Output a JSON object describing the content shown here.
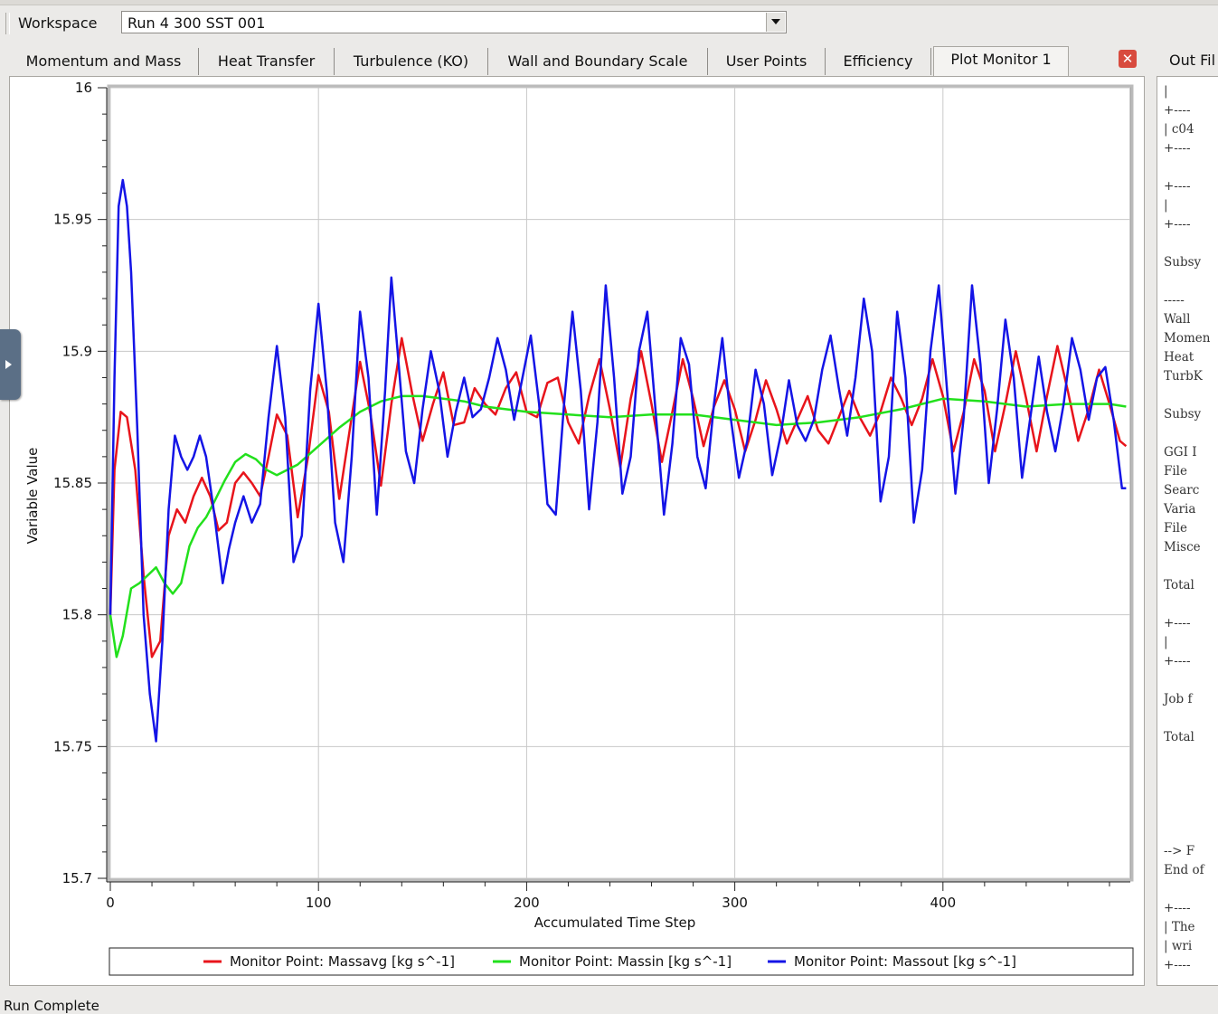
{
  "workspace": {
    "label": "Workspace",
    "selected": "Run 4 300 SST 001"
  },
  "tabs": [
    {
      "label": "Momentum and Mass",
      "active": false
    },
    {
      "label": "Heat Transfer",
      "active": false
    },
    {
      "label": "Turbulence (KO)",
      "active": false
    },
    {
      "label": "Wall and Boundary Scale",
      "active": false
    },
    {
      "label": "User Points",
      "active": false
    },
    {
      "label": "Efficiency",
      "active": false
    },
    {
      "label": "Plot Monitor 1",
      "active": true
    }
  ],
  "close_icon": "close-icon",
  "out_panel": {
    "tab_label": "Out Fil",
    "lines": [
      "|",
      "+----",
      "| c04",
      "+----",
      "",
      "+----",
      "|",
      "+----",
      "",
      "Subsy",
      "",
      "-----",
      "Wall ",
      "Momen",
      "Heat ",
      "TurbK",
      "",
      "Subsy",
      "",
      "GGI I",
      "File ",
      "Searc",
      "Varia",
      "File ",
      "Misce",
      "",
      "Total",
      "",
      "+----",
      "|",
      "+----",
      "",
      "Job f",
      "",
      "Total",
      "",
      "",
      "",
      "",
      "",
      "--> F",
      "End of",
      "",
      "+----",
      "| The",
      "| wri",
      "+----"
    ]
  },
  "status_text": "Run Complete",
  "chart_data": {
    "type": "line",
    "title": "",
    "xlabel": "Accumulated Time Step",
    "ylabel": "Variable Value",
    "xlim": [
      0,
      490
    ],
    "ylim": [
      15.7,
      16.0
    ],
    "xticks": [
      0,
      100,
      200,
      300,
      400
    ],
    "yticks": [
      15.7,
      15.75,
      15.8,
      15.85,
      15.9,
      15.95,
      16
    ],
    "ytick_labels": [
      "15.7",
      "15.75",
      "15.8",
      "15.85",
      "15.9",
      "15.95",
      "16"
    ],
    "grid": true,
    "legend_position": "bottom",
    "series": [
      {
        "name": "Monitor Point: Massavg [kg s^-1]",
        "color": "#e8141b",
        "x": [
          0,
          2,
          5,
          8,
          12,
          16,
          20,
          24,
          28,
          32,
          36,
          40,
          44,
          48,
          52,
          56,
          60,
          64,
          68,
          72,
          76,
          80,
          85,
          90,
          95,
          100,
          105,
          110,
          115,
          120,
          125,
          130,
          135,
          140,
          145,
          150,
          155,
          160,
          165,
          170,
          175,
          180,
          185,
          190,
          195,
          200,
          205,
          210,
          215,
          220,
          225,
          230,
          235,
          240,
          245,
          250,
          255,
          260,
          265,
          270,
          275,
          280,
          285,
          290,
          295,
          300,
          305,
          310,
          315,
          320,
          325,
          330,
          335,
          340,
          345,
          350,
          355,
          360,
          365,
          370,
          375,
          380,
          385,
          390,
          395,
          400,
          405,
          410,
          415,
          420,
          425,
          430,
          435,
          440,
          445,
          450,
          455,
          460,
          465,
          470,
          475,
          480,
          485,
          488
        ],
        "y": [
          15.8,
          15.855,
          15.877,
          15.875,
          15.855,
          15.815,
          15.784,
          15.79,
          15.83,
          15.84,
          15.835,
          15.845,
          15.852,
          15.845,
          15.832,
          15.835,
          15.85,
          15.854,
          15.85,
          15.845,
          15.86,
          15.876,
          15.868,
          15.837,
          15.86,
          15.891,
          15.877,
          15.844,
          15.87,
          15.896,
          15.876,
          15.849,
          15.88,
          15.905,
          15.884,
          15.866,
          15.88,
          15.892,
          15.872,
          15.873,
          15.886,
          15.88,
          15.876,
          15.886,
          15.892,
          15.877,
          15.875,
          15.888,
          15.89,
          15.873,
          15.865,
          15.883,
          15.897,
          15.878,
          15.856,
          15.882,
          15.9,
          15.88,
          15.858,
          15.877,
          15.897,
          15.882,
          15.864,
          15.879,
          15.889,
          15.878,
          15.862,
          15.874,
          15.889,
          15.878,
          15.865,
          15.874,
          15.883,
          15.87,
          15.865,
          15.875,
          15.885,
          15.875,
          15.868,
          15.877,
          15.89,
          15.882,
          15.872,
          15.882,
          15.897,
          15.883,
          15.862,
          15.877,
          15.897,
          15.885,
          15.862,
          15.88,
          15.9,
          15.882,
          15.862,
          15.883,
          15.902,
          15.885,
          15.866,
          15.878,
          15.893,
          15.88,
          15.866,
          15.864
        ]
      },
      {
        "name": "Monitor Point: Massin [kg s^-1]",
        "color": "#22e01c",
        "x": [
          0,
          3,
          6,
          10,
          14,
          18,
          22,
          26,
          30,
          34,
          38,
          42,
          46,
          50,
          55,
          60,
          65,
          70,
          75,
          80,
          90,
          100,
          110,
          120,
          130,
          140,
          150,
          160,
          170,
          180,
          190,
          200,
          220,
          240,
          260,
          280,
          300,
          320,
          340,
          360,
          380,
          400,
          420,
          440,
          460,
          480,
          488
        ],
        "y": [
          15.8,
          15.784,
          15.792,
          15.81,
          15.812,
          15.815,
          15.818,
          15.812,
          15.808,
          15.812,
          15.826,
          15.833,
          15.837,
          15.843,
          15.851,
          15.858,
          15.861,
          15.859,
          15.855,
          15.853,
          15.857,
          15.864,
          15.871,
          15.877,
          15.881,
          15.883,
          15.883,
          15.882,
          15.881,
          15.879,
          15.878,
          15.877,
          15.876,
          15.875,
          15.876,
          15.876,
          15.874,
          15.872,
          15.873,
          15.875,
          15.878,
          15.882,
          15.881,
          15.879,
          15.88,
          15.88,
          15.879
        ]
      },
      {
        "name": "Monitor Point: Massout [kg s^-1]",
        "color": "#1414e6",
        "x": [
          0,
          2,
          4,
          6,
          8,
          10,
          13,
          16,
          19,
          22,
          25,
          28,
          31,
          34,
          37,
          40,
          43,
          46,
          50,
          54,
          57,
          60,
          64,
          68,
          72,
          76,
          80,
          84,
          88,
          92,
          96,
          100,
          104,
          108,
          112,
          116,
          120,
          124,
          128,
          132,
          135,
          138,
          142,
          146,
          150,
          154,
          158,
          162,
          166,
          170,
          174,
          178,
          182,
          186,
          190,
          194,
          198,
          202,
          206,
          210,
          214,
          218,
          222,
          226,
          230,
          234,
          238,
          242,
          246,
          250,
          254,
          258,
          262,
          266,
          270,
          274,
          278,
          282,
          286,
          290,
          294,
          298,
          302,
          306,
          310,
          314,
          318,
          322,
          326,
          330,
          334,
          338,
          342,
          346,
          350,
          354,
          358,
          362,
          366,
          370,
          374,
          378,
          382,
          386,
          390,
          394,
          398,
          402,
          406,
          410,
          414,
          418,
          422,
          426,
          430,
          434,
          438,
          442,
          446,
          450,
          454,
          458,
          462,
          466,
          470,
          474,
          478,
          482,
          486,
          488
        ],
        "y": [
          15.8,
          15.89,
          15.955,
          15.965,
          15.955,
          15.93,
          15.87,
          15.8,
          15.77,
          15.752,
          15.79,
          15.84,
          15.868,
          15.86,
          15.855,
          15.86,
          15.868,
          15.86,
          15.838,
          15.812,
          15.825,
          15.835,
          15.845,
          15.835,
          15.842,
          15.875,
          15.902,
          15.875,
          15.82,
          15.83,
          15.885,
          15.918,
          15.885,
          15.835,
          15.82,
          15.86,
          15.915,
          15.89,
          15.838,
          15.885,
          15.928,
          15.9,
          15.862,
          15.85,
          15.878,
          15.9,
          15.885,
          15.86,
          15.877,
          15.89,
          15.875,
          15.878,
          15.89,
          15.905,
          15.893,
          15.874,
          15.89,
          15.906,
          15.88,
          15.842,
          15.838,
          15.88,
          15.915,
          15.885,
          15.84,
          15.873,
          15.925,
          15.89,
          15.846,
          15.86,
          15.9,
          15.915,
          15.877,
          15.838,
          15.865,
          15.905,
          15.895,
          15.86,
          15.848,
          15.88,
          15.905,
          15.875,
          15.852,
          15.866,
          15.893,
          15.88,
          15.853,
          15.868,
          15.889,
          15.872,
          15.866,
          15.874,
          15.893,
          15.906,
          15.886,
          15.868,
          15.89,
          15.92,
          15.9,
          15.843,
          15.86,
          15.915,
          15.89,
          15.835,
          15.855,
          15.9,
          15.925,
          15.885,
          15.846,
          15.875,
          15.925,
          15.895,
          15.85,
          15.878,
          15.912,
          15.89,
          15.852,
          15.875,
          15.898,
          15.877,
          15.862,
          15.88,
          15.905,
          15.893,
          15.874,
          15.89,
          15.894,
          15.874,
          15.848,
          15.848
        ]
      }
    ]
  }
}
